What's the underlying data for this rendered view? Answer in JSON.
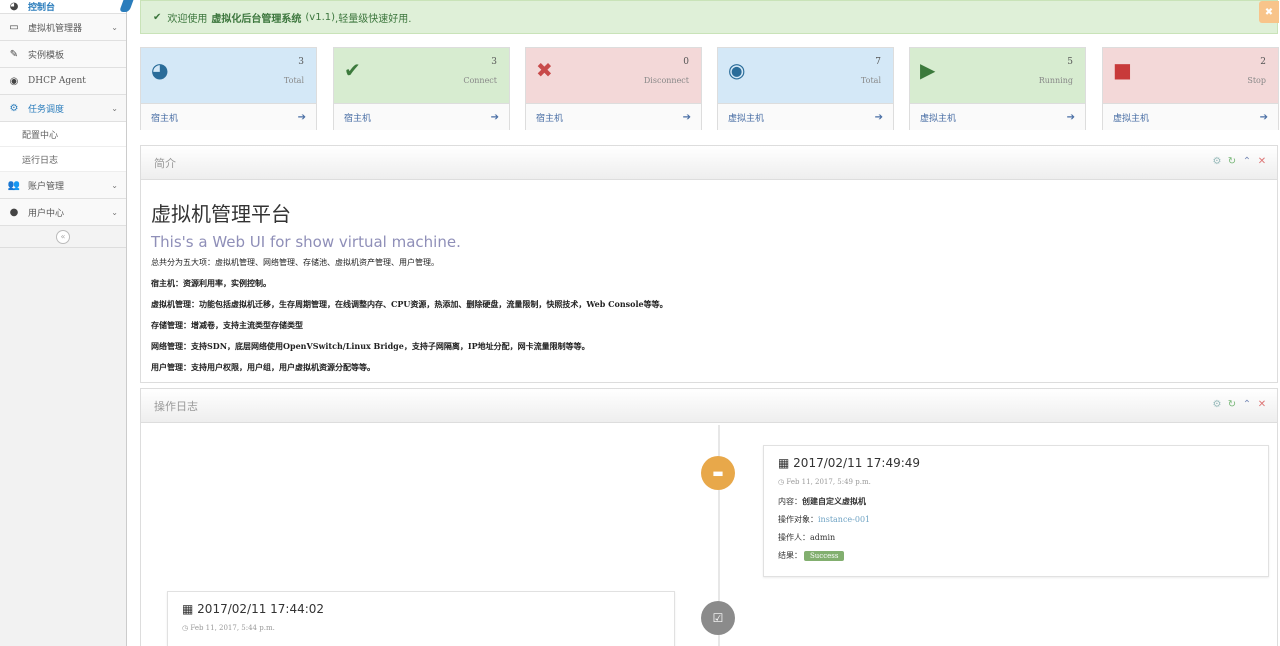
{
  "sidebar": {
    "items": [
      {
        "label": "控制台",
        "icon": "dashboard-icon"
      },
      {
        "label": "虚拟机管理器",
        "icon": "desktop-icon"
      },
      {
        "label": "实例模板",
        "icon": "wrench-icon"
      },
      {
        "label": "DHCP Agent",
        "icon": "globe-icon"
      },
      {
        "label": "任务调度",
        "icon": "cogs-icon"
      },
      {
        "label": "账户管理",
        "icon": "users-icon"
      },
      {
        "label": "用户中心",
        "icon": "user-icon"
      }
    ],
    "subitems": [
      "配置中心",
      "运行日志"
    ],
    "collapse_glyph": "«"
  },
  "alert": {
    "prefix": "欢迎使用",
    "brand": "虚拟化后台管理系统",
    "version": "(v1.1)",
    "suffix": ",轻量级快速好用.",
    "check_glyph": "✔",
    "close_glyph": "✖"
  },
  "cards": [
    {
      "num": "3",
      "label": "Total",
      "link": "宿主机",
      "icon": "dashboard-icon",
      "glyph": "◕",
      "bg": "blue",
      "color": "#2a6c99"
    },
    {
      "num": "3",
      "label": "Connect",
      "link": "宿主机",
      "icon": "check-icon",
      "glyph": "✔",
      "bg": "green",
      "color": "#3c7a3c"
    },
    {
      "num": "0",
      "label": "Disconnect",
      "link": "宿主机",
      "icon": "times-icon",
      "glyph": "✖",
      "bg": "red",
      "color": "#c84a4a"
    },
    {
      "num": "7",
      "label": "Total",
      "link": "虚拟主机",
      "icon": "globe-icon",
      "glyph": "◉",
      "bg": "blue",
      "color": "#2a6c99"
    },
    {
      "num": "5",
      "label": "Running",
      "link": "虚拟主机",
      "icon": "play-circle-icon",
      "glyph": "▶",
      "bg": "green",
      "color": "#3c7a3c"
    },
    {
      "num": "2",
      "label": "Stop",
      "link": "虚拟主机",
      "icon": "stop-icon",
      "glyph": "■",
      "bg": "red",
      "color": "#c83a3a"
    }
  ],
  "card_arrow": "➔",
  "intro": {
    "heading": "简介",
    "title": "虚拟机管理平台",
    "subtitle": "This's a Web UI for show virtual machine.",
    "lines": [
      "总共分为五大项：虚拟机管理、网络管理、存储池、虚拟机资产管理、用户管理。",
      "宿主机：资源利用率，实例控制。",
      "虚拟机管理：功能包括虚拟机迁移，生存周期管理，在线调整内存、CPU资源，热添加、删除硬盘，流量限制，快照技术，Web Console等等。",
      "存储管理：增减卷，支持主流类型存储类型",
      "网络管理：支持SDN，底层网络使用OpenVSwitch/Linux Bridge，支持子网隔离，IP地址分配，网卡流量限制等等。",
      "用户管理：支持用户权限，用户组，用户虚拟机资源分配等等。"
    ]
  },
  "oplog": {
    "heading": "操作日志",
    "entries": [
      {
        "date": "2017/02/11 17:49:49",
        "time": "Feb  11, 2017, 5:49 p.m.",
        "content_label": "内容：",
        "content": "创建自定义虚拟机",
        "target_label": "操作对象：",
        "target": "instance-001",
        "operator_label": "操作人：",
        "operator": "admin",
        "result_label": "结果：",
        "result": "Success",
        "badge_color": "#e8a84a",
        "badge_icon": "credit-card-icon"
      },
      {
        "date": "2017/02/11 17:44:02",
        "time": "Feb  11, 2017, 5:44 p.m.",
        "badge_color": "#8b8b8b",
        "badge_icon": "check-square-icon"
      }
    ]
  },
  "tools": {
    "gear": "⚙",
    "refresh": "↻",
    "up": "⌃",
    "close": "✕"
  }
}
